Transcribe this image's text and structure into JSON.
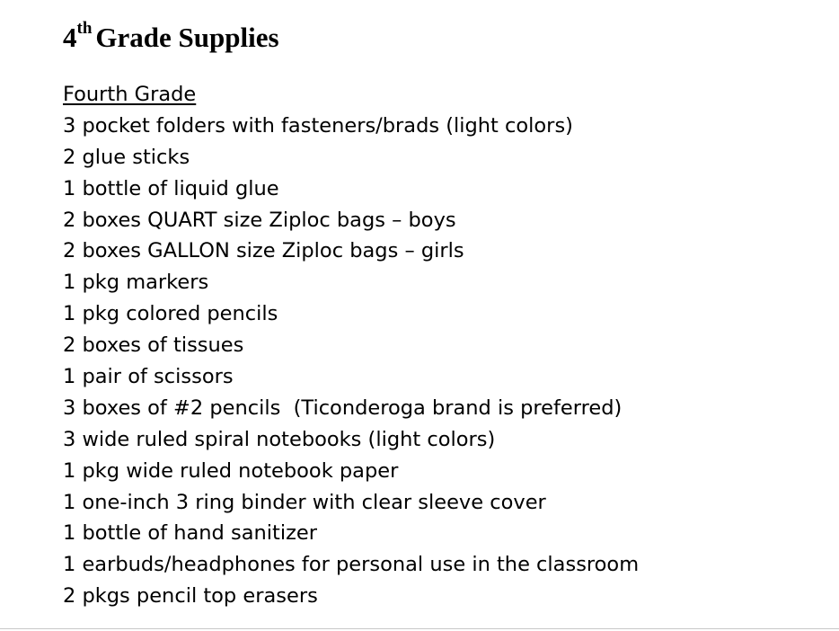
{
  "document": {
    "title_number": "4",
    "title_superscript": "th",
    "title_rest": "Grade Supplies",
    "section_heading": "Fourth Grade",
    "items": [
      "3 pocket folders with fasteners/brads (light colors)",
      "2 glue sticks",
      "1 bottle of liquid glue",
      "2 boxes QUART size Ziploc bags – boys",
      "2 boxes GALLON size Ziploc bags – girls",
      "1 pkg markers",
      "1 pkg colored pencils",
      "2 boxes of tissues",
      "1 pair of scissors",
      "3 boxes of #2 pencils  (Ticonderoga brand is preferred)",
      "3 wide ruled spiral notebooks (light colors)",
      "1 pkg wide ruled notebook paper",
      "1 one-inch 3 ring binder with clear sleeve cover",
      "1 bottle of hand sanitizer",
      "1 earbuds/headphones for personal use in the classroom",
      "2 pkgs pencil top erasers"
    ]
  }
}
